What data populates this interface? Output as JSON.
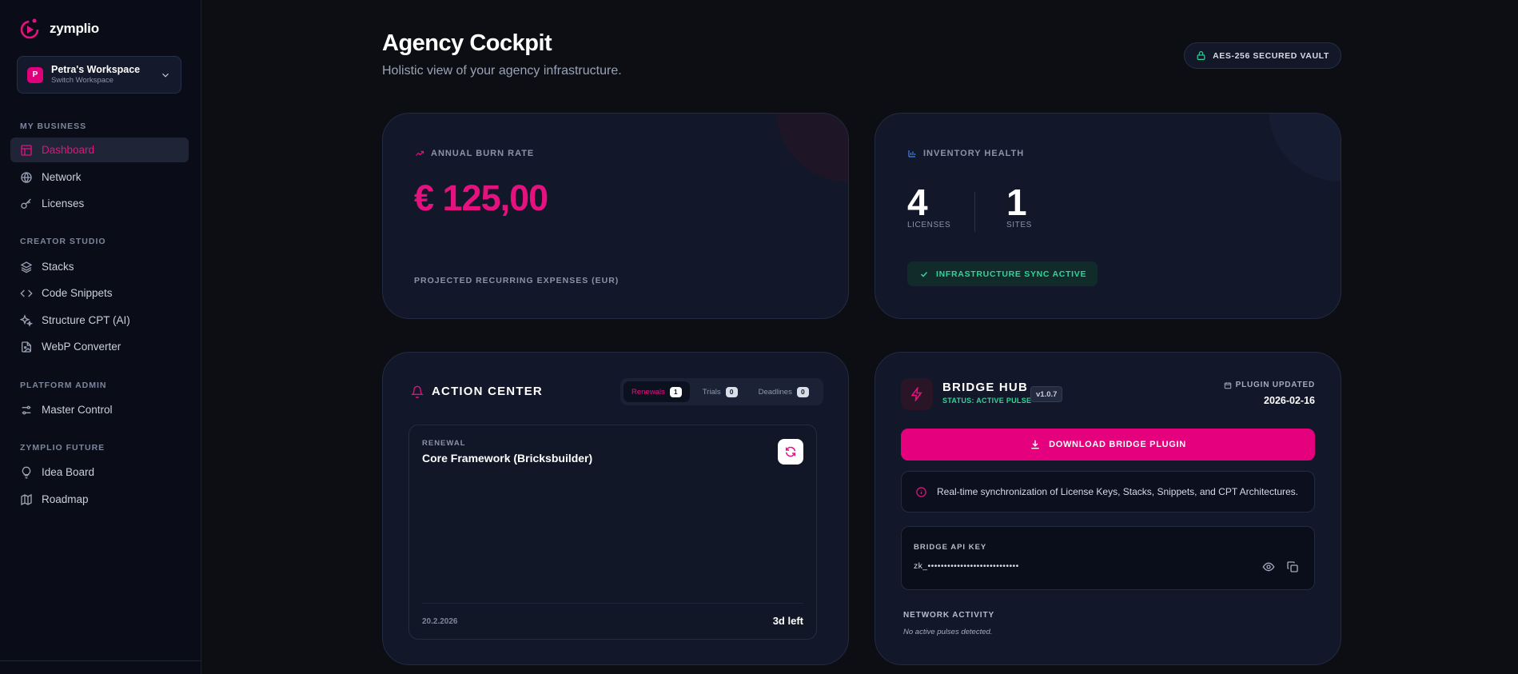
{
  "brand": {
    "name": "zymplio",
    "accent": "#e5117f"
  },
  "workspace": {
    "initial": "P",
    "name": "Petra's Workspace",
    "sub": "Switch Workspace"
  },
  "sidebar": {
    "sections": [
      {
        "label": "MY BUSINESS"
      },
      {
        "label": "CREATOR STUDIO"
      },
      {
        "label": "PLATFORM ADMIN"
      },
      {
        "label": "ZYMPLIO FUTURE"
      }
    ],
    "items": [
      {
        "label": "Dashboard",
        "icon": "layout-icon",
        "active": true
      },
      {
        "label": "Network",
        "icon": "globe-icon"
      },
      {
        "label": "Licenses",
        "icon": "key-icon"
      },
      {
        "label": "Stacks",
        "icon": "layers-icon"
      },
      {
        "label": "Code Snippets",
        "icon": "code-icon"
      },
      {
        "label": "Structure CPT (AI)",
        "icon": "sparkles-icon"
      },
      {
        "label": "WebP Converter",
        "icon": "file-image-icon"
      },
      {
        "label": "Master Control",
        "icon": "sliders-icon"
      },
      {
        "label": "Idea Board",
        "icon": "lightbulb-icon"
      },
      {
        "label": "Roadmap",
        "icon": "map-icon"
      }
    ]
  },
  "header": {
    "title": "Agency Cockpit",
    "subtitle": "Holistic view of your agency infrastructure.",
    "vault_badge": "AES-256 SECURED VAULT"
  },
  "burn_rate": {
    "label": "ANNUAL BURN RATE",
    "value": "€ 125,00",
    "footnote": "PROJECTED RECURRING EXPENSES (EUR)"
  },
  "inventory": {
    "label": "INVENTORY HEALTH",
    "licenses_count": "4",
    "licenses_label": "LICENSES",
    "sites_count": "1",
    "sites_label": "SITES",
    "sync_status": "INFRASTRUCTURE SYNC ACTIVE"
  },
  "action_center": {
    "title": "ACTION CENTER",
    "tabs": [
      {
        "label": "Renewals",
        "count": "1",
        "active": true
      },
      {
        "label": "Trials",
        "count": "0"
      },
      {
        "label": "Deadlines",
        "count": "0"
      }
    ],
    "item": {
      "kind": "RENEWAL",
      "title": "Core Framework (Bricksbuilder)",
      "date": "20.2.2026",
      "remaining": "3d left"
    }
  },
  "bridge_hub": {
    "title": "BRIDGE HUB",
    "status": "STATUS: ACTIVE PULSE",
    "version": "v1.0.7",
    "updated_label": "PLUGIN UPDATED",
    "updated_date": "2026-02-16",
    "download_label": "DOWNLOAD BRIDGE PLUGIN",
    "info": "Real-time synchronization of License Keys, Stacks, Snippets, and CPT Architectures.",
    "api_key_label": "BRIDGE API KEY",
    "api_key_value": "zk_••••••••••••••••••••••••••••",
    "network_label": "NETWORK ACTIVITY",
    "network_empty": "No active pulses detected."
  }
}
